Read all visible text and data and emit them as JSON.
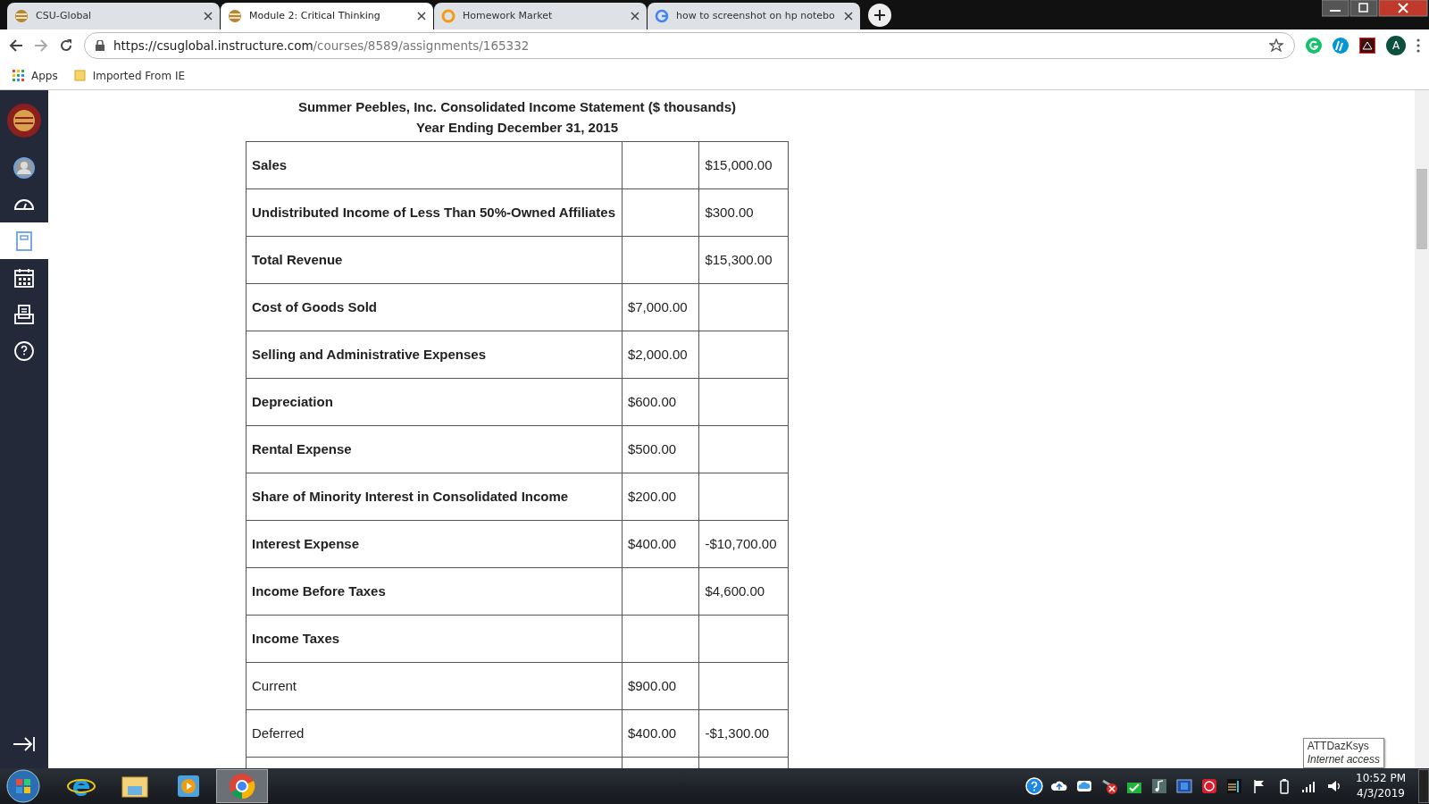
{
  "browser_tabs": [
    {
      "title": "CSU-Global",
      "selected": false,
      "kind": "course"
    },
    {
      "title": "Module 2: Critical Thinking",
      "selected": true,
      "kind": "course"
    },
    {
      "title": "Homework Market",
      "selected": false,
      "kind": "market"
    },
    {
      "title": "how to screenshot on hp notebo",
      "selected": false,
      "kind": "search"
    }
  ],
  "address_bar": {
    "host": "https://csuglobal.instructure.com",
    "path": "/courses/8589/assignments/165332"
  },
  "profile": {
    "initial": "A"
  },
  "bookmarks": [
    {
      "label": "Apps",
      "kind": "apps"
    },
    {
      "label": "Imported From IE",
      "kind": "folder"
    }
  ],
  "sidebar": {
    "items": [
      {
        "kind": "account",
        "selected": false
      },
      {
        "kind": "dashboard",
        "selected": false
      },
      {
        "kind": "courses",
        "selected": true
      },
      {
        "kind": "calendar",
        "selected": false
      },
      {
        "kind": "inbox",
        "selected": false
      },
      {
        "kind": "help",
        "selected": false
      }
    ]
  },
  "statement": {
    "title": "Summer Peebles, Inc. Consolidated Income Statement ($ thousands)",
    "subtitle": "Year Ending December 31, 2015",
    "rows": [
      {
        "label": "Sales",
        "bold": true,
        "column_2": "",
        "column_3": "$15,000.00"
      },
      {
        "label": "Undistributed Income of Less Than 50%-Owned Affiliates",
        "bold": true,
        "column_2": "",
        "column_3": "$300.00"
      },
      {
        "label": "Total Revenue",
        "bold": true,
        "column_2": "",
        "column_3": "$15,300.00"
      },
      {
        "label": "Cost of Goods Sold",
        "bold": true,
        "column_2": "$7,000.00",
        "column_3": ""
      },
      {
        "label": "Selling and Administrative Expenses",
        "bold": true,
        "column_2": "$2,000.00",
        "column_3": ""
      },
      {
        "label": "Depreciation",
        "bold": true,
        "column_2": "$600.00",
        "column_3": ""
      },
      {
        "label": "Rental Expense",
        "bold": true,
        "column_2": "$500.00",
        "column_3": ""
      },
      {
        "label": "Share of Minority Interest in Consolidated Income",
        "bold": true,
        "column_2": "$200.00",
        "column_3": ""
      },
      {
        "label": "Interest Expense",
        "bold": true,
        "column_2": "$400.00",
        "column_3": "-$10,700.00"
      },
      {
        "label": "Income Before Taxes",
        "bold": true,
        "column_2": "",
        "column_3": "$4,600.00"
      },
      {
        "label": "Income Taxes",
        "bold": true,
        "column_2": "",
        "column_3": ""
      },
      {
        "label": "Current",
        "bold": false,
        "column_2": "$900.00",
        "column_3": ""
      },
      {
        "label": "Deferred",
        "bold": false,
        "column_2": "$400.00",
        "column_3": "-$1,300.00"
      }
    ]
  },
  "network_tooltip": {
    "name": "ATTDazKsys",
    "status": "Internet access"
  },
  "taskbar": {
    "apps": [
      {
        "kind": "ie",
        "selected": false
      },
      {
        "kind": "explorer",
        "selected": false
      },
      {
        "kind": "media",
        "selected": false
      },
      {
        "kind": "chrome",
        "selected": true
      }
    ],
    "clock": {
      "time": "10:52 PM",
      "date": "4/3/2019"
    }
  }
}
